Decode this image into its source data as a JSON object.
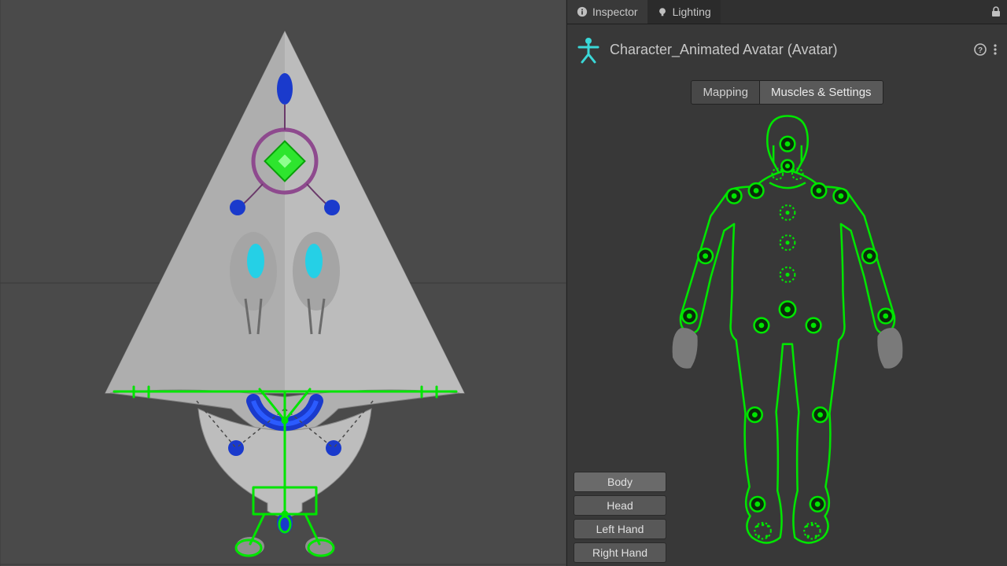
{
  "tabs": {
    "inspector": "Inspector",
    "lighting": "Lighting"
  },
  "asset": {
    "name": "Character_Animated Avatar (Avatar)"
  },
  "subtabs": {
    "mapping": "Mapping",
    "muscles": "Muscles & Settings",
    "active": "mapping"
  },
  "body_parts": {
    "body": "Body",
    "head": "Head",
    "left_hand": "Left Hand",
    "right_hand": "Right Hand",
    "active": "body"
  },
  "colors": {
    "rig_green": "#00e500",
    "accent_cyan": "#3ad8d8",
    "node_blue": "#1a3acc"
  }
}
